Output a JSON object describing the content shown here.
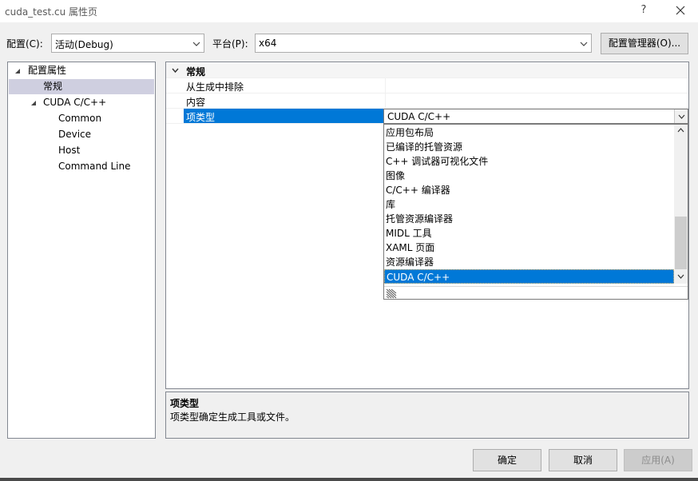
{
  "window": {
    "title": "cuda_test.cu 属性页",
    "help_label": "?",
    "close_icon": "close-icon"
  },
  "config_bar": {
    "config_label": "配置(C):",
    "config_value": "活动(Debug)",
    "platform_label": "平台(P):",
    "platform_value": "x64",
    "config_manager_label": "配置管理器(O)..."
  },
  "tree": {
    "items": [
      {
        "label": "配置属性",
        "expanded": true
      },
      {
        "label": "常规",
        "selected": true
      },
      {
        "label": "CUDA C/C++",
        "expanded": true
      },
      {
        "label": "Common"
      },
      {
        "label": "Device"
      },
      {
        "label": "Host"
      },
      {
        "label": "Command Line"
      }
    ]
  },
  "grid": {
    "category": "常规",
    "rows": [
      {
        "name": "从生成中排除",
        "value": ""
      },
      {
        "name": "内容",
        "value": ""
      },
      {
        "name": "项类型",
        "value": "CUDA C/C++",
        "selected": true
      }
    ]
  },
  "dropdown": {
    "value": "CUDA C/C++",
    "options": [
      "应用包布局",
      "已编译的托管资源",
      "C++ 调试器可视化文件",
      "图像",
      "C/C++ 编译器",
      "库",
      "托管资源编译器",
      "MIDL 工具",
      "XAML 页面",
      "资源编译器",
      "CUDA C/C++"
    ],
    "selected_index": 10
  },
  "description": {
    "title": "项类型",
    "text": "项类型确定生成工具或文件。"
  },
  "buttons": {
    "ok": "确定",
    "cancel": "取消",
    "apply": "应用(A)"
  },
  "colors": {
    "selection": "#0078d7",
    "tree_selection": "#cfcfe0",
    "disabled_text": "#8d8d8d"
  }
}
